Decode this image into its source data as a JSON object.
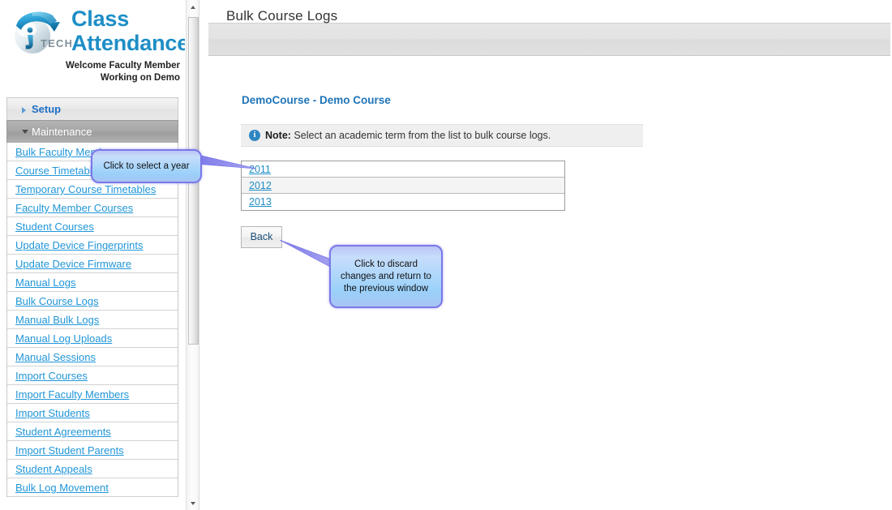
{
  "brand": {
    "logo_icon": "iptech-globe-logo",
    "title_line1": "Class",
    "title_line2": "Attendance",
    "welcome_line1": "Welcome Faculty Member",
    "welcome_line2": "Working on Demo",
    "accent_color": "#1e8ec6"
  },
  "sidebar": {
    "sections": [
      {
        "label": "Setup",
        "expanded": false,
        "arrow_icon": "chevron-right-icon"
      },
      {
        "label": "Maintenance",
        "expanded": true,
        "arrow_icon": "chevron-down-icon"
      }
    ],
    "items": [
      {
        "label": "Bulk Faculty Members"
      },
      {
        "label": "Course Timetables"
      },
      {
        "label": "Temporary Course Timetables"
      },
      {
        "label": "Faculty Member Courses"
      },
      {
        "label": "Student Courses"
      },
      {
        "label": "Update Device Fingerprints"
      },
      {
        "label": "Update Device Firmware"
      },
      {
        "label": "Manual Logs"
      },
      {
        "label": "Bulk Course Logs"
      },
      {
        "label": "Manual Bulk Logs"
      },
      {
        "label": "Manual Log Uploads"
      },
      {
        "label": "Manual Sessions"
      },
      {
        "label": "Import Courses"
      },
      {
        "label": "Import Faculty Members"
      },
      {
        "label": "Import Students"
      },
      {
        "label": "Student Agreements"
      },
      {
        "label": "Import Student Parents"
      },
      {
        "label": "Student Appeals"
      },
      {
        "label": "Bulk Log Movement"
      }
    ],
    "link_color": "#2196d8"
  },
  "scrollbar": {
    "up_icon": "scroll-up-arrow-icon",
    "down_icon": "scroll-down-arrow-icon",
    "thumb_name": "scrollbar-thumb"
  },
  "main": {
    "panel_title": "Bulk Course Logs",
    "course_title": "DemoCourse - Demo Course",
    "note": {
      "icon": "info-icon",
      "label": "Note:",
      "text": " Select an academic term from the list to bulk course logs."
    },
    "years": [
      {
        "label": "2011"
      },
      {
        "label": "2012"
      },
      {
        "label": "2013"
      }
    ],
    "back_label": "Back"
  },
  "callouts": [
    {
      "text": "Click to select a year"
    },
    {
      "text": "Click to discard changes and return to the previous window"
    }
  ]
}
